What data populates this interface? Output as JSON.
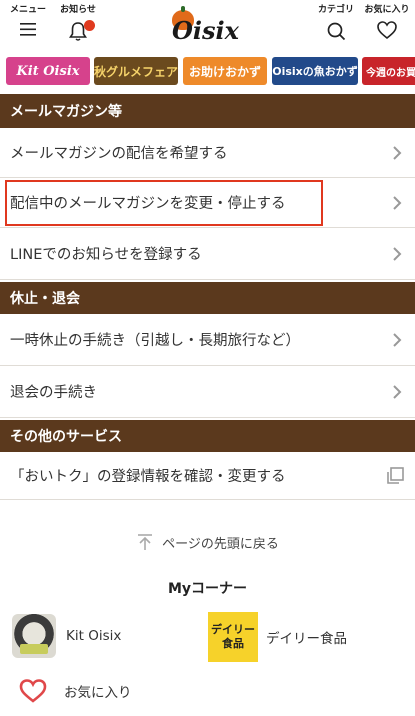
{
  "header": {
    "menu_label": "メニュー",
    "notif_label": "お知らせ",
    "logo_text": "Oisix",
    "category_label": "カテゴリ",
    "favorites_label": "お気に入り"
  },
  "banners": [
    {
      "label": "Kit Oisix"
    },
    {
      "label": "秋グルメフェア"
    },
    {
      "label": "お助けおかず"
    },
    {
      "label": "Oisixの魚おかず"
    },
    {
      "label": "今週のお買い"
    }
  ],
  "sections": {
    "mail": {
      "title": "メールマガジン等",
      "items": [
        "メールマガジンの配信を希望する",
        "配信中のメールマガジンを変更・停止する",
        "LINEでのお知らせを登録する"
      ]
    },
    "pause": {
      "title": "休止・退会",
      "items": [
        "一時休止の手続き（引越し・長期旅行など）",
        "退会の手続き"
      ]
    },
    "other": {
      "title": "その他のサービス",
      "items": [
        "「おいトク」の登録情報を確認・変更する"
      ]
    }
  },
  "pagetop": "ページの先頭に戻る",
  "mycorner": {
    "title": "Myコーナー",
    "items": [
      "Kit Oisix",
      "デイリー食品",
      "お気に入り"
    ],
    "daily_badge_line1": "デイリー",
    "daily_badge_line2": "食品"
  },
  "colors": {
    "section_bg": "#5b391d",
    "highlight": "#e0381f",
    "notification_dot": "#e03a1f"
  }
}
